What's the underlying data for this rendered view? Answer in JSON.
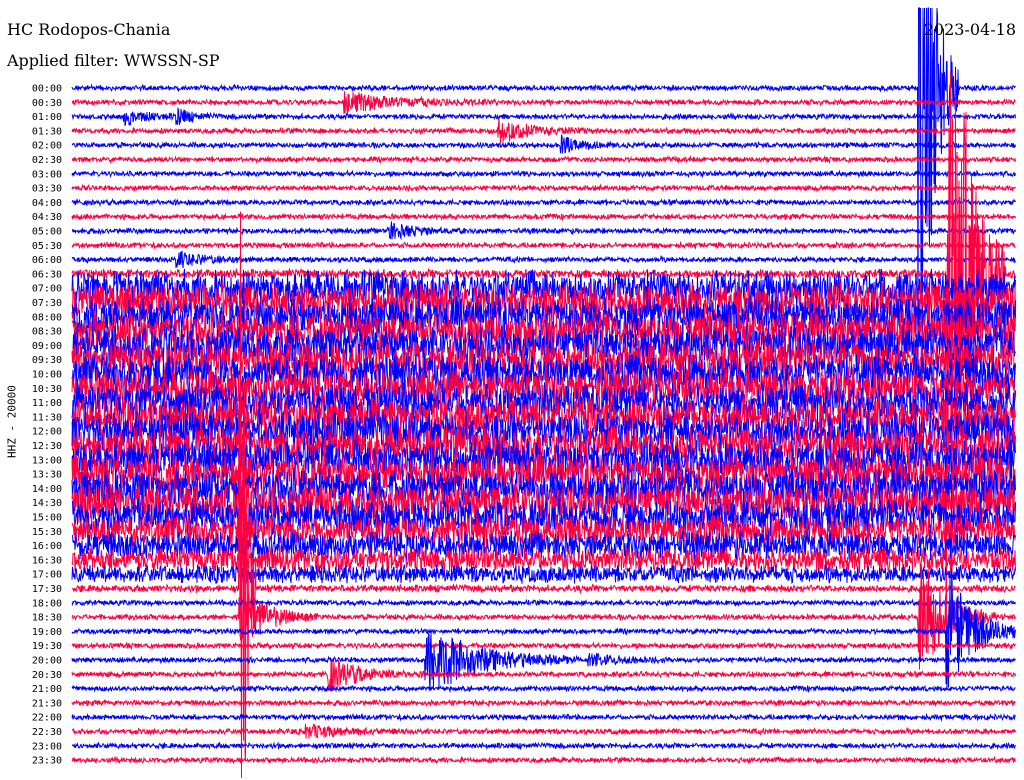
{
  "header": {
    "station": "HC Rodopos-Chania",
    "filter": "Applied filter: WWSSN-SP",
    "date": "2023-04-18"
  },
  "chart_data": {
    "type": "line",
    "title": "HC Rodopos-Chania",
    "subtitle": "Applied filter: WWSSN-SP",
    "ylabel": "HHZ - 20000",
    "xlabel": "",
    "row_minutes": 30,
    "colors": [
      "#0000ff",
      "#ff0040"
    ],
    "rows": [
      "00:00",
      "00:30",
      "01:00",
      "01:30",
      "02:00",
      "02:30",
      "03:00",
      "03:30",
      "04:00",
      "04:30",
      "05:00",
      "05:30",
      "06:00",
      "06:30",
      "07:00",
      "07:30",
      "08:00",
      "08:30",
      "09:00",
      "09:30",
      "10:00",
      "10:30",
      "11:00",
      "11:30",
      "12:00",
      "12:30",
      "13:00",
      "13:30",
      "14:00",
      "14:30",
      "15:00",
      "15:30",
      "16:00",
      "16:30",
      "17:00",
      "17:30",
      "18:00",
      "18:30",
      "19:00",
      "19:30",
      "20:00",
      "20:30",
      "21:00",
      "21:30",
      "22:00",
      "22:30",
      "23:00",
      "23:30"
    ],
    "noise_level": [
      3,
      3,
      3,
      3,
      3,
      3,
      3,
      3,
      3,
      3,
      3,
      3,
      3,
      5,
      20,
      22,
      22,
      22,
      22,
      22,
      22,
      22,
      22,
      22,
      22,
      22,
      22,
      22,
      22,
      22,
      20,
      18,
      16,
      14,
      10,
      4,
      3,
      3,
      3,
      3,
      3,
      3,
      3,
      3,
      3,
      3,
      3,
      3
    ],
    "events": [
      {
        "row": "00:30",
        "minute": 8.7,
        "amp": 10,
        "dur": 1.5
      },
      {
        "row": "01:00",
        "minute": 1.7,
        "amp": 8,
        "dur": 0.6
      },
      {
        "row": "01:00",
        "minute": 3.4,
        "amp": 7,
        "dur": 0.4
      },
      {
        "row": "01:30",
        "minute": 13.6,
        "amp": 12,
        "dur": 1.0
      },
      {
        "row": "02:00",
        "minute": 15.6,
        "amp": 8,
        "dur": 0.6
      },
      {
        "row": "05:00",
        "minute": 10.1,
        "amp": 8,
        "dur": 0.8
      },
      {
        "row": "06:00",
        "minute": 3.4,
        "amp": 7,
        "dur": 0.8
      },
      {
        "row": "06:30",
        "minute": 27.9,
        "amp": 400,
        "dur": 0.6
      },
      {
        "row": "00:00",
        "minute": 27.0,
        "amp": 350,
        "dur": 0.4
      },
      {
        "row": "17:30",
        "minute": 5.4,
        "amp": 420,
        "dur": 0.15
      },
      {
        "row": "18:30",
        "minute": 5.4,
        "amp": 30,
        "dur": 0.8
      },
      {
        "row": "18:30",
        "minute": 27.0,
        "amp": 60,
        "dur": 0.8
      },
      {
        "row": "19:00",
        "minute": 27.9,
        "amp": 60,
        "dur": 0.8
      },
      {
        "row": "20:00",
        "minute": 11.3,
        "amp": 35,
        "dur": 1.6
      },
      {
        "row": "20:00",
        "minute": 16.5,
        "amp": 6,
        "dur": 0.8
      },
      {
        "row": "20:30",
        "minute": 8.2,
        "amp": 15,
        "dur": 1.0
      },
      {
        "row": "22:30",
        "minute": 7.5,
        "amp": 6,
        "dur": 1.0
      }
    ]
  }
}
